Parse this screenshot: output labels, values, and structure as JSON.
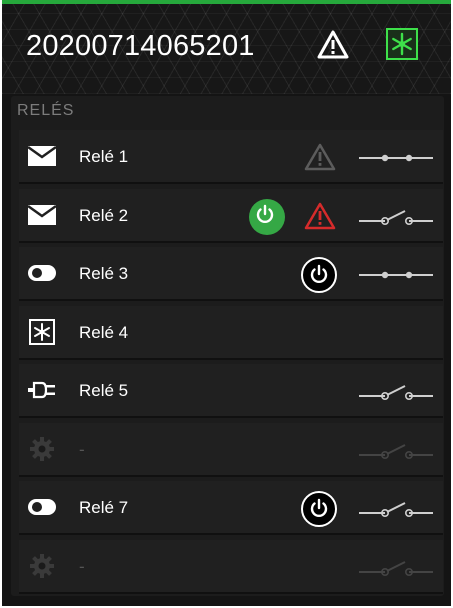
{
  "header": {
    "device_id": "20200714065201",
    "warning_icon": "warning-triangle-icon",
    "fan_icon": "fan-icon",
    "accent_color": "#26a83c"
  },
  "section_title": "RELÉS",
  "relays": [
    {
      "label": "Relé 1",
      "icon": "envelope-icon",
      "warning": "gray",
      "power": null,
      "switch": "closed",
      "enabled": true
    },
    {
      "label": "Relé 2",
      "icon": "envelope-icon",
      "warning": "red",
      "power": "green",
      "switch": "open",
      "enabled": true
    },
    {
      "label": "Relé 3",
      "icon": "toggle-icon",
      "warning": null,
      "power": "dark",
      "switch": "closed",
      "enabled": true
    },
    {
      "label": "Relé 4",
      "icon": "fan-icon",
      "warning": null,
      "power": null,
      "switch": null,
      "enabled": true
    },
    {
      "label": "Relé 5",
      "icon": "plug-icon",
      "warning": null,
      "power": null,
      "switch": "open",
      "enabled": true
    },
    {
      "label": "-",
      "icon": "gear-icon",
      "warning": null,
      "power": null,
      "switch": "open",
      "enabled": false
    },
    {
      "label": "Relé 7",
      "icon": "toggle-icon",
      "warning": null,
      "power": "dark",
      "switch": "open",
      "enabled": true
    },
    {
      "label": "-",
      "icon": "gear-icon",
      "warning": null,
      "power": null,
      "switch": "open",
      "enabled": false
    }
  ]
}
